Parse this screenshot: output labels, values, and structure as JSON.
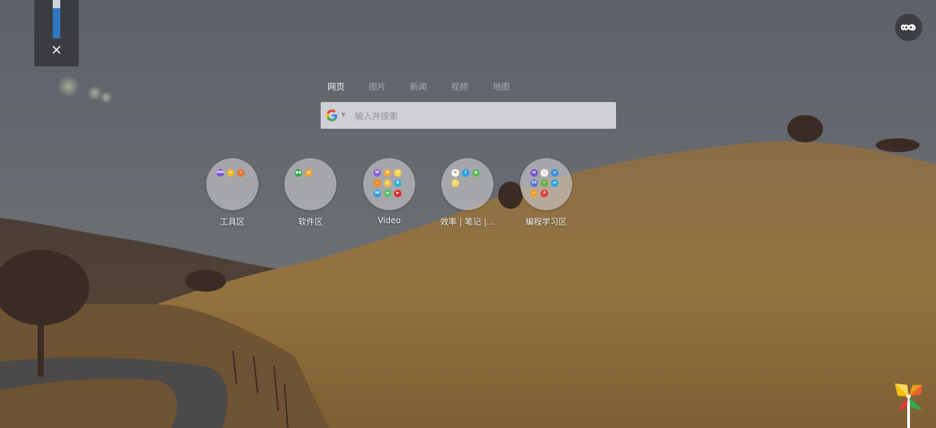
{
  "side_panel": {
    "level_fraction": 0.78,
    "close_glyph": "✕"
  },
  "top_right": {
    "icon": "infinity-icon"
  },
  "search": {
    "tabs": [
      {
        "label": "网页",
        "active": true
      },
      {
        "label": "图片",
        "active": false
      },
      {
        "label": "新闻",
        "active": false
      },
      {
        "label": "视频",
        "active": false
      },
      {
        "label": "地图",
        "active": false
      }
    ],
    "engine_icon": "google-icon",
    "placeholder": "输入并搜索",
    "value": ""
  },
  "folders": [
    {
      "label": "工具区",
      "icons": [
        {
          "name": "app-icon",
          "color": "#7b4fcf",
          "text": "iMM"
        },
        {
          "name": "app-icon",
          "color": "#f2b51f",
          "text": "▬"
        },
        {
          "name": "firefox-icon",
          "color": "#e8722a",
          "text": "◎"
        }
      ]
    },
    {
      "label": "软件区",
      "icons": [
        {
          "name": "app-icon",
          "color": "#2aa84a",
          "text": "●●"
        },
        {
          "name": "grid-app-icon",
          "color": "#f0a020",
          "text": "▦"
        }
      ]
    },
    {
      "label": "Video",
      "icons": [
        {
          "name": "app-icon",
          "color": "#8b5cd6",
          "text": "W"
        },
        {
          "name": "app-icon",
          "color": "#f2a23a",
          "text": "B"
        },
        {
          "name": "app-icon",
          "color": "#f5d34a",
          "text": "☺"
        },
        {
          "name": "app-icon",
          "color": "#f08a24",
          "text": "━"
        },
        {
          "name": "app-icon",
          "color": "#f3c14a",
          "text": "◐"
        },
        {
          "name": "app-icon",
          "color": "#2fb3d6",
          "text": "B"
        },
        {
          "name": "app-icon",
          "color": "#2f9ae0",
          "text": "MI"
        },
        {
          "name": "app-icon",
          "color": "#5abf6a",
          "text": "▬"
        },
        {
          "name": "youtube-icon",
          "color": "#e22b2b",
          "text": "▶"
        }
      ]
    },
    {
      "label": "效率 | 笔记 |...",
      "icons": [
        {
          "name": "app-icon",
          "color": "#ffffff",
          "text": "π"
        },
        {
          "name": "app-icon",
          "color": "#2aa0e6",
          "text": "ʃ"
        },
        {
          "name": "app-icon",
          "color": "#58b85a",
          "text": "▦"
        },
        {
          "name": "app-icon",
          "color": "#f4d85a",
          "text": "✉"
        }
      ]
    },
    {
      "label": "编程学习区",
      "icons": [
        {
          "name": "app-icon",
          "color": "#7a57d1",
          "text": "m"
        },
        {
          "name": "app-icon",
          "color": "#f4f4f4",
          "text": "▯"
        },
        {
          "name": "app-icon",
          "color": "#3b8fe0",
          "text": "≡"
        },
        {
          "name": "app-icon",
          "color": "#5a6fd8",
          "text": "VS"
        },
        {
          "name": "app-icon",
          "color": "#6ab04c",
          "text": "━"
        },
        {
          "name": "app-icon",
          "color": "#2aa6e0",
          "text": "▬"
        },
        {
          "name": "app-icon",
          "color": "#f0a030",
          "text": "━"
        },
        {
          "name": "app-icon",
          "color": "#e53935",
          "text": "A"
        }
      ]
    }
  ],
  "bottom_right": {
    "icon": "pinwheel-icon"
  }
}
